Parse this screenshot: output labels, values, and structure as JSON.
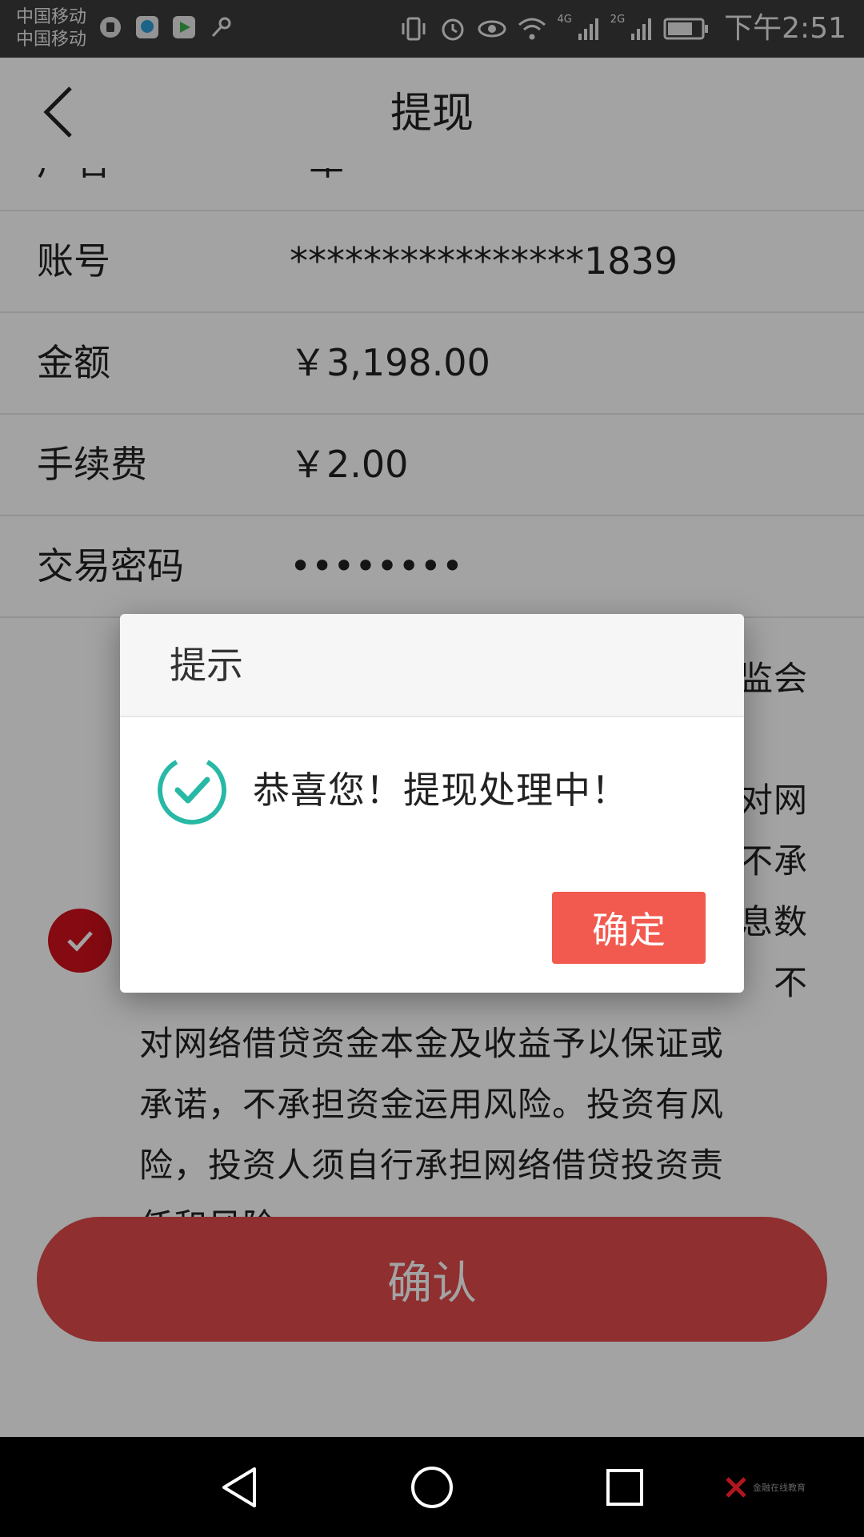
{
  "status_bar": {
    "carrier_1": "中国移动",
    "carrier_2": "中国移动",
    "signal_1_tag": "4G",
    "signal_2_tag": "2G",
    "time": "下午2:51",
    "left_icons": [
      "app-circle-icon",
      "app-blue-icon",
      "video-app-icon",
      "key-icon"
    ],
    "right_icons": [
      "vibrate-icon",
      "alarm-icon",
      "eye-icon",
      "wifi-icon",
      "signal-icon",
      "battery-icon"
    ]
  },
  "nav": {
    "title": "提现",
    "back_icon": "chevron-left-icon"
  },
  "form": {
    "partial_row": {
      "label_fragment": "户名",
      "value_fragment": "*军"
    },
    "rows": [
      {
        "label": "账号",
        "value": "****************1839"
      },
      {
        "label": "金额",
        "value": "￥3,198.00"
      },
      {
        "label": "手续费",
        "value": "￥2.00"
      },
      {
        "label": "交易密码",
        "value": "••••••••"
      }
    ]
  },
  "disclaimer": {
    "line_1_fragment": "监会",
    "line_2_fragment": "对网",
    "line_3_fragment": "不承",
    "line_4_fragment": "息数",
    "line_5_fragment": "不",
    "line_6": "对网络借贷资金本金及收益予以保证或",
    "line_7": "承诺，不承担资金运用风险。投资有风",
    "line_8": "险，投资人须自行承担网络借贷投资责",
    "line_9": "任和风险。"
  },
  "confirm_button": {
    "label": "确认"
  },
  "dialog": {
    "title": "提示",
    "message": "恭喜您！提现处理中！",
    "ok_label": "确定",
    "icon": "check-circle-icon"
  },
  "colors": {
    "accent_red": "#d0111b",
    "dialog_button": "#f25a4f",
    "success_teal": "#28b9a6",
    "status_bar": "#3a3a3a"
  },
  "navigation_bar": {
    "keys": [
      "back-triangle-icon",
      "home-circle-icon",
      "recents-square-icon"
    ],
    "watermark_text": "金融在线教育"
  }
}
